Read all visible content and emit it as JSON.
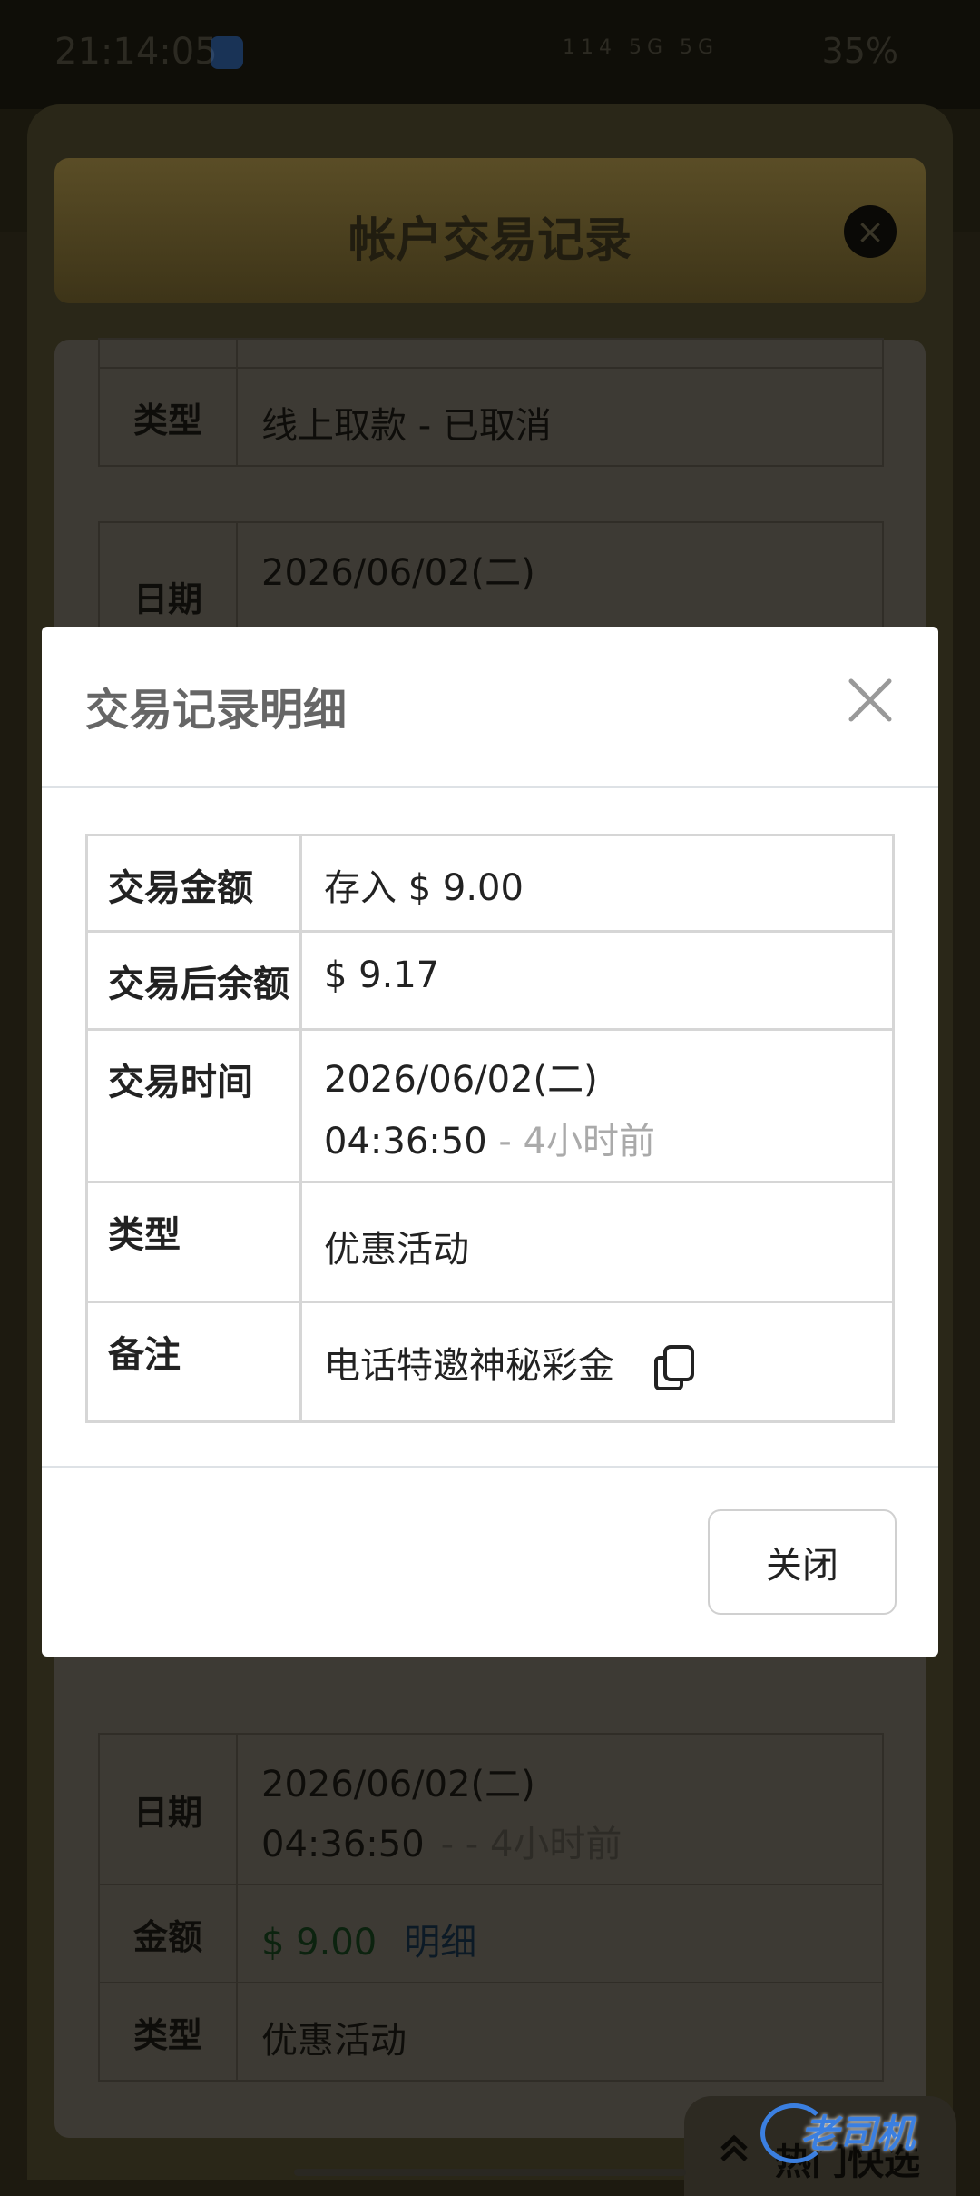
{
  "status_bar": {
    "time": "21:14:05",
    "battery": "35%",
    "net_text": "114 5G 5G"
  },
  "background": {
    "title": "帐户交易记录",
    "close_glyph": "×",
    "record_top": {
      "type_label": "类型",
      "type_value": "线上取款 - 已取消"
    },
    "record_partial": {
      "date_label": "日期",
      "date_value": "2026/06/02(二)"
    },
    "record_bottom": {
      "date_label": "日期",
      "date_line1": "2026/06/02(二)",
      "date_line2": "04:36:50",
      "date_ago": "- - 4小时前",
      "amount_label": "金额",
      "amount_value": "$ 9.00",
      "detail_link": "明细",
      "type_label": "类型",
      "type_value": "优惠活动"
    },
    "fab_label": "热门快选"
  },
  "modal": {
    "title": "交易记录明细",
    "rows": [
      {
        "label": "交易金额",
        "value": "存入 $ 9.00"
      },
      {
        "label": "交易后余额",
        "value": "$ 9.17"
      },
      {
        "label": "交易时间",
        "value_line1": "2026/06/02(二)",
        "value_line2": "04:36:50",
        "ago": "- 4小时前"
      },
      {
        "label": "类型",
        "value": "优惠活动"
      },
      {
        "label": "备注",
        "value": "电话特邀神秘彩金"
      }
    ],
    "close_button": "关闭"
  },
  "watermark": "老司机"
}
